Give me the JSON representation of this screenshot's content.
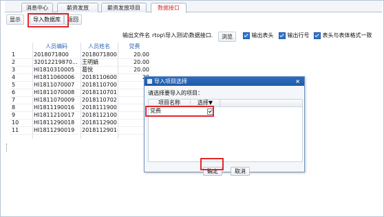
{
  "tabs": [
    {
      "label": "消息中心",
      "active": false
    },
    {
      "label": "薪资发放",
      "active": false
    },
    {
      "label": "薪资发放项目",
      "active": false
    },
    {
      "label": "数据接口",
      "active": true
    }
  ],
  "toolbar": {
    "display_label": "显示",
    "import_label": "导入数据库",
    "back_label": "返回"
  },
  "options": {
    "output_filename_label": "输出文件名",
    "output_filename_value": "rtop\\导入测试\\数据接口.xls",
    "browse_label": "浏览",
    "output_header_label": "输出表头",
    "output_rowno_label": "输出行号",
    "header_match_label": "表头与表体格式一致"
  },
  "grid": {
    "columns": [
      "",
      "人员编码",
      "人员姓名",
      "党费"
    ],
    "rows": [
      [
        "1",
        "2018071800",
        "2018071800",
        "20.00"
      ],
      [
        "2",
        "32012219870...",
        "王明娟",
        "20.00"
      ],
      [
        "3",
        "HI1810310005",
        "葛悦",
        "20.00"
      ],
      [
        "4",
        "HI1811060006",
        "2018110600",
        "20"
      ],
      [
        "5",
        "HI1811070007",
        "2018110700",
        "2"
      ],
      [
        "6",
        "HI1811070008",
        "2018110701",
        "2"
      ],
      [
        "7",
        "HI1811070009",
        "2018110702",
        "2"
      ],
      [
        "8",
        "HI1811190016",
        "2018111900",
        "2"
      ],
      [
        "9",
        "HI1811210017",
        "2018112100",
        "2"
      ],
      [
        "10",
        "HI1811290018",
        "2018112900",
        "2"
      ],
      [
        "11",
        "HI1811290019",
        "2018112901",
        "2"
      ]
    ]
  },
  "dialog": {
    "title": "导入项目选择",
    "close_glyph": "×",
    "prompt": "请选择要导入的项目：",
    "columns": [
      "项目名称",
      "选择▼"
    ],
    "rows": [
      {
        "name": "党费",
        "checked": true
      }
    ],
    "ok_label": "确定",
    "cancel_label": "取消"
  },
  "colors": {
    "accent": "#2f74d0",
    "highlight": "#e0262a",
    "header_text": "#2a62b8"
  }
}
